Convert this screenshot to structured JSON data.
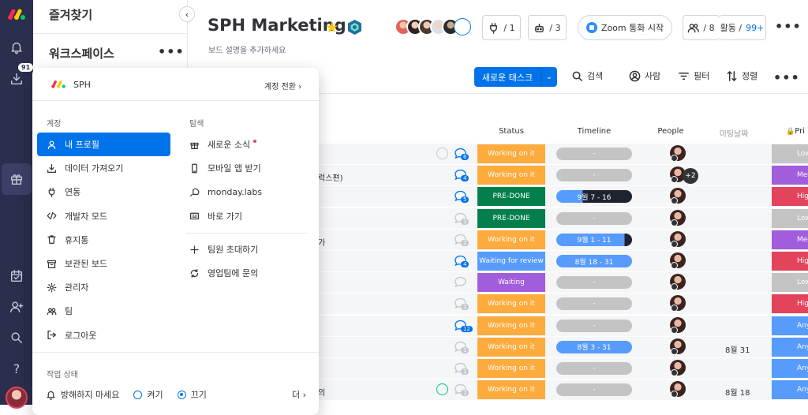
{
  "rail": {
    "download_badge": "91"
  },
  "sidebar": {
    "favorites": "즐겨찾기",
    "workspace": "워크스페이스",
    "more": "•••"
  },
  "board": {
    "title": "SPH Marketing",
    "subtitle": "보드 설명을 추가하세요",
    "integrate_count": "/ 1",
    "automate_count": "/ 3",
    "zoom_label": "Zoom 통화 시작",
    "members_count": "/ 8",
    "activity_label": "활동 /",
    "activity_count": "99+",
    "more": "•••"
  },
  "toolbar": {
    "new_task": "새로운 태스크",
    "search": "검색",
    "person": "사람",
    "filter": "필터",
    "sort": "정렬",
    "more": "•••"
  },
  "columns": {
    "status": "Status",
    "timeline": "Timeline",
    "people": "People",
    "meeting_date": "미팅날짜",
    "priority": "Pri"
  },
  "colors": {
    "working": "#fdab3d",
    "done": "#037f4c",
    "waiting_review": "#579bfc",
    "waiting": "#a25ddc",
    "low": "#c4c4c4",
    "medium": "#a25ddc",
    "high": "#e2445c",
    "any": "#579bfc",
    "accent": "#0073ea"
  },
  "rows": [
    {
      "name": "",
      "status": "Working on it",
      "status_color": "#fdab3d",
      "timeline": "-",
      "timeline_progress": 0,
      "date": "",
      "priority": "Low",
      "priority_color": "#c4c4c4",
      "updates": "6",
      "check": true,
      "extra_people": ""
    },
    {
      "name": "럭스편)",
      "status": "Working on it",
      "status_color": "#fdab3d",
      "timeline": "-",
      "timeline_progress": 0,
      "date": "",
      "priority": "Medium",
      "priority_color": "#a25ddc",
      "updates": "4",
      "check": false,
      "extra_people": "+2"
    },
    {
      "name": "",
      "status": "PRE-DONE",
      "status_color": "#037f4c",
      "timeline": "9월 7 - 16",
      "timeline_progress": 0.35,
      "date": "",
      "priority": "High",
      "priority_color": "#e2445c",
      "updates": "5",
      "check": false,
      "extra_people": ""
    },
    {
      "name": "",
      "status": "PRE-DONE",
      "status_color": "#037f4c",
      "timeline": "-",
      "timeline_progress": 0,
      "date": "",
      "priority": "Low",
      "priority_color": "#c4c4c4",
      "updates": "1",
      "check": false,
      "extra_people": ""
    },
    {
      "name": "가",
      "status": "Working on it",
      "status_color": "#fdab3d",
      "timeline": "9월 1 - 11",
      "timeline_progress": 0.9,
      "date": "",
      "priority": "Medium",
      "priority_color": "#a25ddc",
      "updates": "2",
      "check": false,
      "extra_people": ""
    },
    {
      "name": "",
      "status": "Waiting for review",
      "status_color": "#579bfc",
      "timeline": "8월 18 - 31",
      "timeline_progress": 1,
      "date": "",
      "priority": "High",
      "priority_color": "#e2445c",
      "updates": "4",
      "check": false,
      "extra_people": ""
    },
    {
      "name": "",
      "status": "Waiting",
      "status_color": "#a25ddc",
      "timeline": "-",
      "timeline_progress": 0,
      "date": "",
      "priority": "Low",
      "priority_color": "#c4c4c4",
      "updates": "",
      "check": false,
      "extra_people": ""
    },
    {
      "name": "",
      "status": "Working on it",
      "status_color": "#fdab3d",
      "timeline": "-",
      "timeline_progress": 0,
      "date": "",
      "priority": "High",
      "priority_color": "#e2445c",
      "updates": "1",
      "check": false,
      "extra_people": ""
    },
    {
      "name": "",
      "status": "Working on it",
      "status_color": "#fdab3d",
      "timeline": "-",
      "timeline_progress": 0,
      "date": "",
      "priority": "Any time",
      "priority_color": "#579bfc",
      "updates": "12",
      "check": false,
      "extra_people": ""
    },
    {
      "name": "",
      "status": "Working on it",
      "status_color": "#fdab3d",
      "timeline": "8월 3 - 31",
      "timeline_progress": 1,
      "date": "8월 31",
      "priority": "Any time",
      "priority_color": "#579bfc",
      "updates": "1",
      "check": false,
      "extra_people": ""
    },
    {
      "name": "",
      "status": "Working on it",
      "status_color": "#fdab3d",
      "timeline": "-",
      "timeline_progress": 0,
      "date": "",
      "priority": "Any time",
      "priority_color": "#579bfc",
      "updates": "1",
      "check": false,
      "extra_people": ""
    },
    {
      "name": "의",
      "status": "Working on it",
      "status_color": "#fdab3d",
      "timeline": "-",
      "timeline_progress": 0,
      "date": "8월 18",
      "priority": "Any time",
      "priority_color": "#579bfc",
      "updates": "1",
      "check": true,
      "extra_people": ""
    }
  ],
  "menu": {
    "account_name": "SPH",
    "switch_account": "계정 전환",
    "account_heading": "계정",
    "explore_heading": "탐색",
    "account_items": [
      "내 프로필",
      "데이터 가져오기",
      "연동",
      "개발자 모드",
      "휴지통",
      "보관된 보드",
      "관리자",
      "팀",
      "로그아웃"
    ],
    "explore_items": [
      "새로운 소식",
      "모바일 앱 받기",
      "monday.labs",
      "바로 가기"
    ],
    "explore_items2": [
      "팀원 초대하기",
      "영업팀에 문의"
    ],
    "work_status_heading": "작업 상태",
    "dnd_label": "방해하지 마세요",
    "on_label": "켜기",
    "off_label": "끄기",
    "more_label": "더"
  }
}
